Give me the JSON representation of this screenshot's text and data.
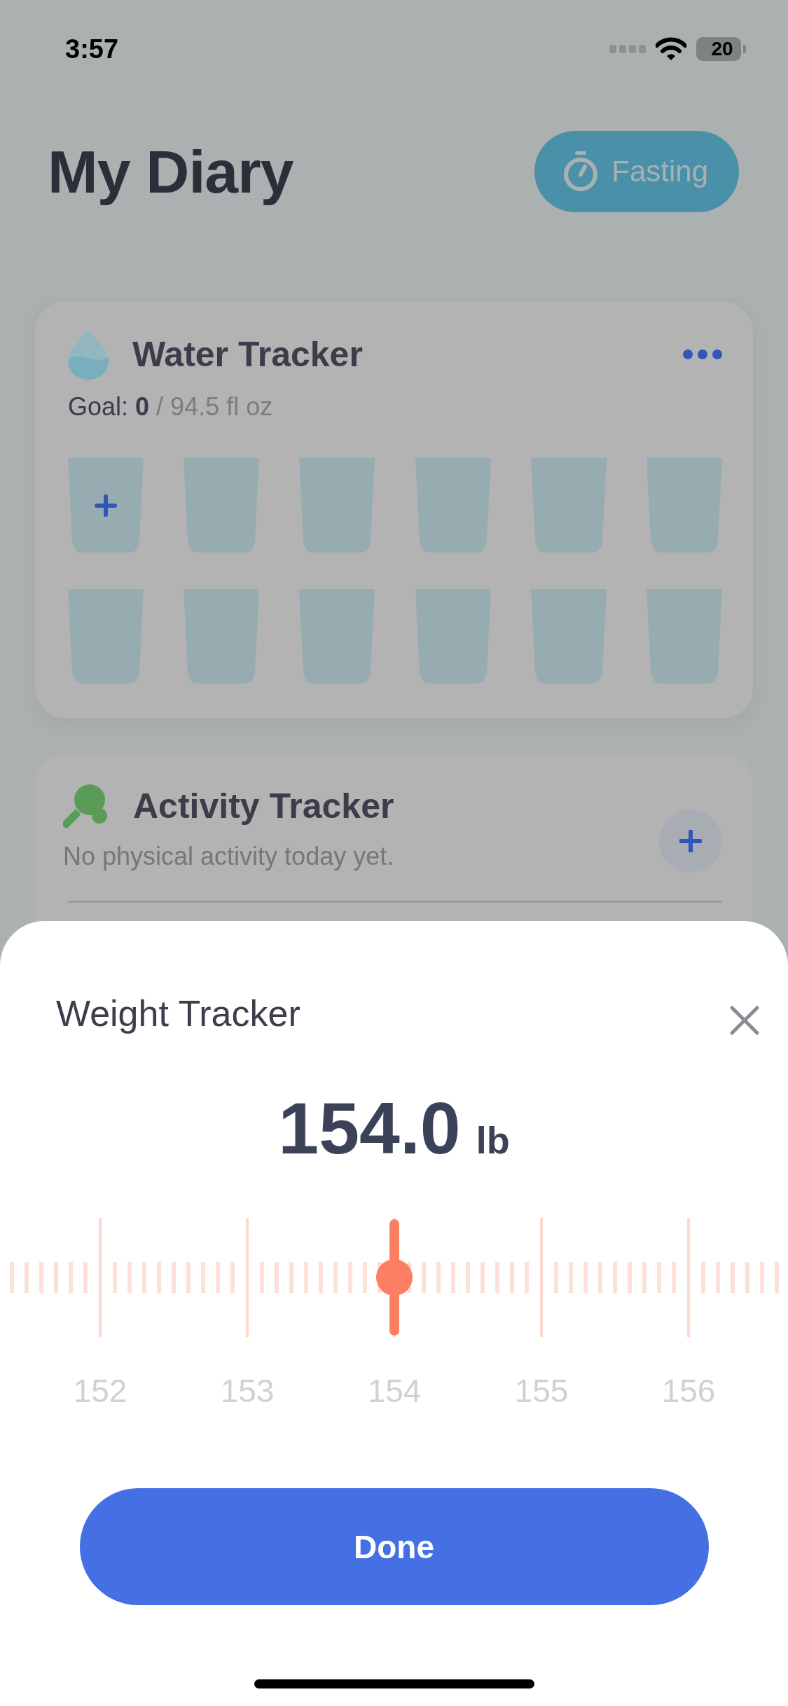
{
  "status_bar": {
    "time": "3:57",
    "battery": "20"
  },
  "header": {
    "title": "My Diary",
    "fasting_button": "Fasting"
  },
  "water_tracker": {
    "title": "Water Tracker",
    "goal_label": "Goal:",
    "goal_value": "0",
    "goal_total": "/ 94.5 fl oz",
    "cups": [
      {
        "kind": "add"
      },
      {
        "kind": "empty"
      },
      {
        "kind": "empty"
      },
      {
        "kind": "empty"
      },
      {
        "kind": "empty"
      },
      {
        "kind": "empty"
      },
      {
        "kind": "empty"
      },
      {
        "kind": "empty"
      },
      {
        "kind": "empty"
      },
      {
        "kind": "empty"
      },
      {
        "kind": "empty"
      },
      {
        "kind": "empty"
      }
    ]
  },
  "activity_tracker": {
    "title": "Activity Tracker",
    "message": "No physical activity today yet."
  },
  "weight_sheet": {
    "title": "Weight Tracker",
    "value": "154.0",
    "unit": "lb",
    "ruler_labels": [
      "152",
      "153",
      "154",
      "155",
      "156"
    ],
    "done_button": "Done"
  }
}
